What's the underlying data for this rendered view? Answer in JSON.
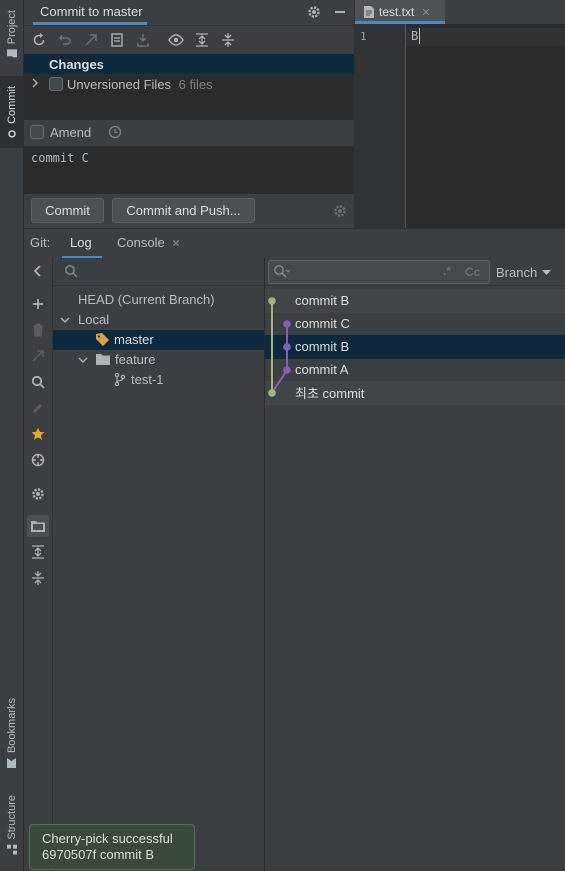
{
  "left_strip": {
    "tabs": [
      {
        "label": "Project",
        "icon": "folder-icon"
      },
      {
        "label": "Commit",
        "icon": "commit-icon"
      },
      {
        "label": "Bookmarks",
        "icon": "bookmark-icon"
      },
      {
        "label": "Structure",
        "icon": "structure-icon"
      }
    ]
  },
  "commit_panel": {
    "title": "Commit to master",
    "changes_label": "Changes",
    "unversioned_label": "Unversioned Files",
    "unversioned_count": "6 files",
    "amend_label": "Amend",
    "message": "commit C",
    "commit_button": "Commit",
    "commit_push_button": "Commit and Push..."
  },
  "editor": {
    "tab_label": "test.txt",
    "line_number": "1",
    "line_text": "B"
  },
  "git_window": {
    "prefix": "Git:",
    "tabs": [
      {
        "label": "Log"
      },
      {
        "label": "Console"
      }
    ],
    "branch_filter_label": "Branch",
    "search_hint": "Cc"
  },
  "branches": {
    "head": "HEAD (Current Branch)",
    "local": "Local",
    "master": "master",
    "feature": "feature",
    "test1": "test-1"
  },
  "log": {
    "commits": [
      {
        "message": "commit B"
      },
      {
        "message": "commit C"
      },
      {
        "message": "commit B"
      },
      {
        "message": "commit A"
      },
      {
        "message": "최초 commit"
      }
    ],
    "colors": {
      "main_branch": "#9fb57a",
      "feature_branch": "#8a5db4",
      "selection": "#0d293e"
    }
  },
  "notification": {
    "line1": "Cherry-pick successful",
    "line2": "6970507f commit B"
  }
}
